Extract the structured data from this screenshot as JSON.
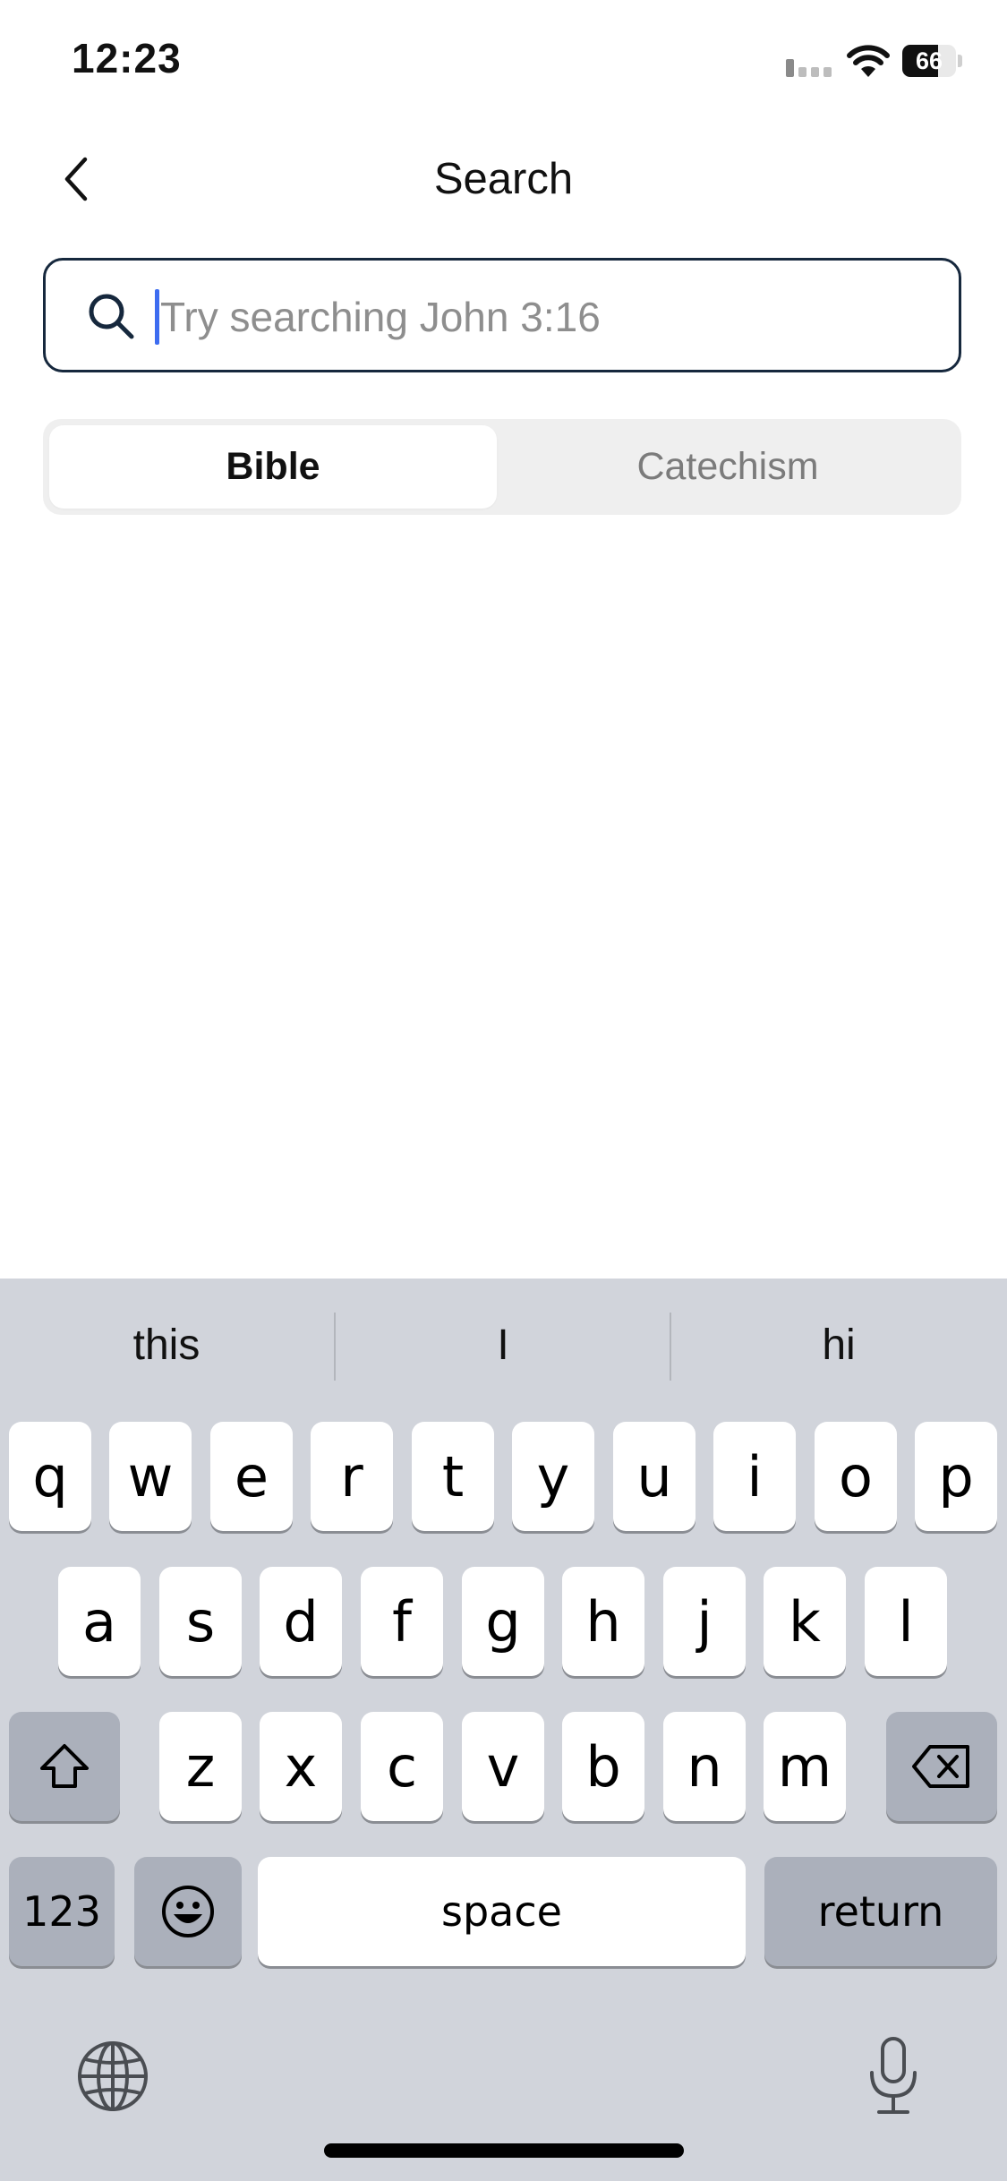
{
  "status_bar": {
    "time": "12:23",
    "battery": "66",
    "battery_level": 0.66
  },
  "header": {
    "title": "Search",
    "back_icon": "chevron-left-icon"
  },
  "search": {
    "placeholder": "Try searching John 3:16",
    "value": ""
  },
  "tabs": [
    {
      "label": "Bible",
      "active": true
    },
    {
      "label": "Catechism",
      "active": false
    }
  ],
  "keyboard": {
    "suggestions": [
      "this",
      "I",
      "hi"
    ],
    "row1": [
      "q",
      "w",
      "e",
      "r",
      "t",
      "y",
      "u",
      "i",
      "o",
      "p"
    ],
    "row2": [
      "a",
      "s",
      "d",
      "f",
      "g",
      "h",
      "j",
      "k",
      "l"
    ],
    "row3": [
      "z",
      "x",
      "c",
      "v",
      "b",
      "n",
      "m"
    ],
    "numbers_label": "123",
    "space_label": "space",
    "return_label": "return"
  },
  "colors": {
    "accent": "#16283d",
    "caret": "#3d6cf0",
    "keyboard_bg": "#d1d4db"
  }
}
